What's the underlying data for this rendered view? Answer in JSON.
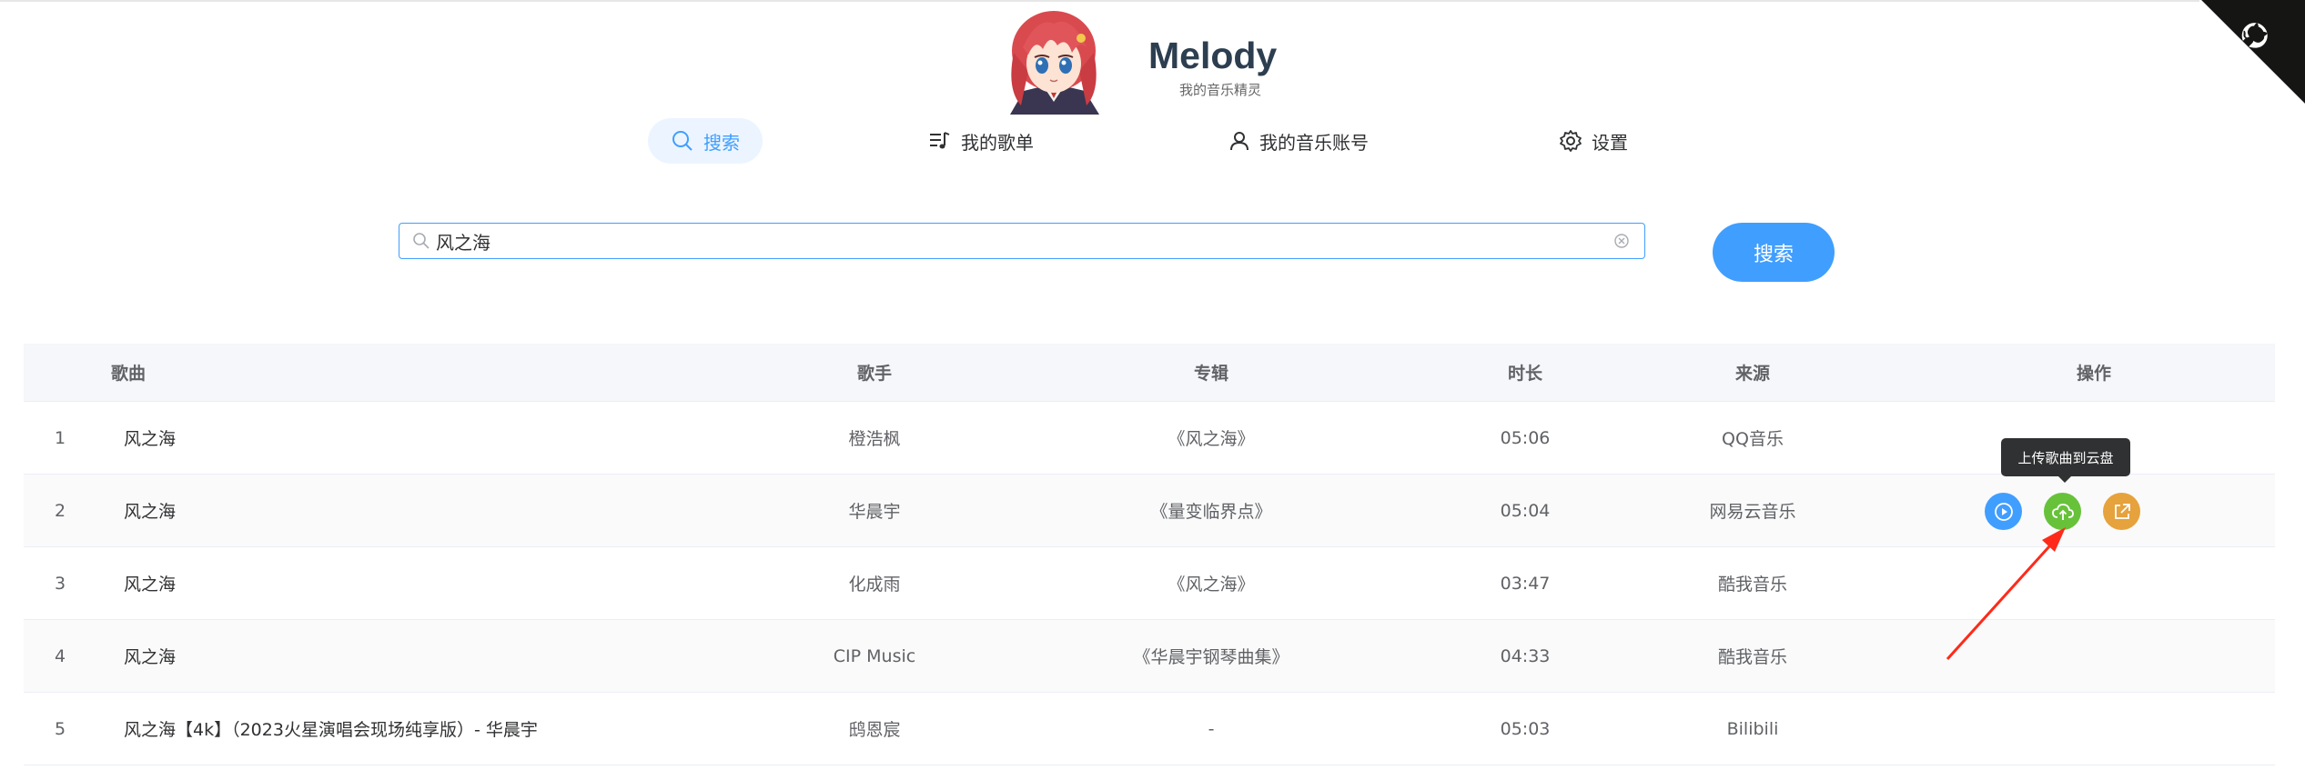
{
  "app": {
    "title": "Melody",
    "subtitle": "我的音乐精灵"
  },
  "nav": [
    {
      "label": "搜索",
      "icon": "search-icon",
      "active": true
    },
    {
      "label": "我的歌单",
      "icon": "playlist-icon",
      "active": false
    },
    {
      "label": "我的音乐账号",
      "icon": "user-icon",
      "active": false
    },
    {
      "label": "设置",
      "icon": "gear-icon",
      "active": false
    }
  ],
  "search": {
    "value": "风之海",
    "placeholder": "",
    "button_label": "搜索"
  },
  "table": {
    "headers": {
      "song": "歌曲",
      "singer": "歌手",
      "album": "专辑",
      "duration": "时长",
      "source": "来源",
      "actions": "操作"
    },
    "rows": [
      {
        "index": "1",
        "song": "风之海",
        "singer": "橙浩枫",
        "album": "《风之海》",
        "duration": "05:06",
        "source": "QQ音乐"
      },
      {
        "index": "2",
        "song": "风之海",
        "singer": "华晨宇",
        "album": "《量变临界点》",
        "duration": "05:04",
        "source": "网易云音乐"
      },
      {
        "index": "3",
        "song": "风之海",
        "singer": "化成雨",
        "album": "《风之海》",
        "duration": "03:47",
        "source": "酷我音乐"
      },
      {
        "index": "4",
        "song": "风之海",
        "singer": "CIP Music",
        "album": "《华晨宇钢琴曲集》",
        "duration": "04:33",
        "source": "酷我音乐"
      },
      {
        "index": "5",
        "song": "风之海【4k】（2023火星演唱会现场纯享版）- 华晨宇",
        "singer": "鸱恩宸",
        "album": "-",
        "duration": "05:03",
        "source": "Bilibili"
      }
    ],
    "hover_row_actions": [
      "play-icon",
      "cloud-upload-icon",
      "external-link-icon"
    ]
  },
  "tooltip": {
    "text": "上传歌曲到云盘"
  },
  "colors": {
    "accent": "#409eff",
    "success": "#67c23a",
    "warning": "#e6a23c",
    "annotation": "#ff2a1a"
  }
}
